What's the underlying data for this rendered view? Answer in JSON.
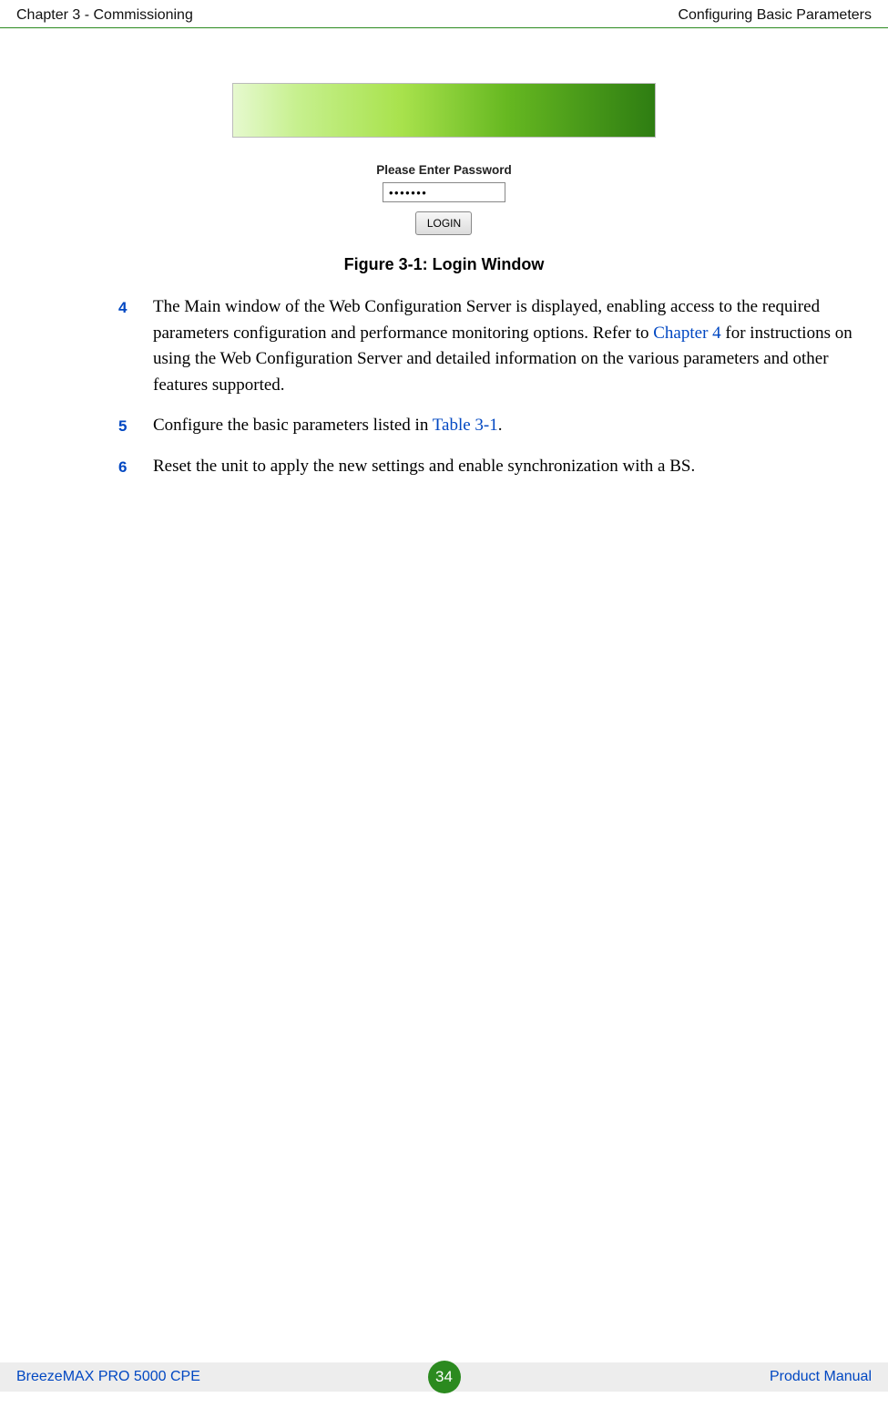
{
  "header": {
    "left": "Chapter 3 - Commissioning",
    "right": "Configuring Basic Parameters"
  },
  "figure": {
    "password_label": "Please Enter Password",
    "password_value": "•••••••",
    "login_button": "LOGIN",
    "caption": "Figure 3-1: Login Window"
  },
  "steps": [
    {
      "num": "4",
      "text_before": "The Main window of the Web Configuration Server is displayed, enabling access to the required parameters configuration and performance monitoring options. Refer to ",
      "link": "Chapter 4",
      "text_after": " for instructions on using the Web Configuration Server and detailed information on the various parameters and other features supported."
    },
    {
      "num": "5",
      "text_before": "Configure the basic parameters listed in ",
      "link": "Table 3-1",
      "text_after": "."
    },
    {
      "num": "6",
      "text_before": "Reset the unit to apply the new settings and enable synchronization with a BS.",
      "link": "",
      "text_after": ""
    }
  ],
  "footer": {
    "left": "BreezeMAX PRO 5000 CPE",
    "page": "34",
    "right": "Product Manual"
  }
}
